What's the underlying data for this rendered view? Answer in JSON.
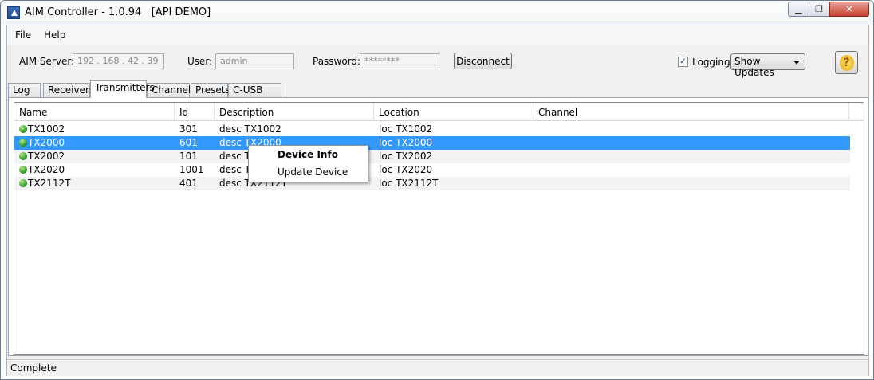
{
  "window": {
    "title": "AIM Controller - 1.0.94   [API DEMO]",
    "minimize": "▁",
    "maximize": "❐",
    "close": "✕"
  },
  "menu": {
    "file": "File",
    "help": "Help"
  },
  "connection": {
    "server_label": "AIM Server:",
    "server_value": "192 . 168 . 42 . 39",
    "user_label": "User:",
    "user_value": "admin",
    "password_label": "Password:",
    "password_value": "********",
    "disconnect_label": "Disconnect",
    "logging_label": "Logging",
    "logging_checked": "✓",
    "updates_select": "Show Updates",
    "help_icon": "?"
  },
  "tabs": [
    "Log",
    "Receivers",
    "Transmitters",
    "Channels",
    "Presets",
    "C-USB LAN"
  ],
  "active_tab": "Transmitters",
  "table": {
    "columns": [
      "Name",
      "Id",
      "Description",
      "Location",
      "Channel"
    ],
    "rows": [
      {
        "name": "TX1002",
        "id": "301",
        "description": "desc TX1002",
        "location": "loc TX1002",
        "channel": ""
      },
      {
        "name": "TX2000",
        "id": "601",
        "description": "desc TX2000",
        "location": "loc TX2000",
        "channel": ""
      },
      {
        "name": "TX2002",
        "id": "101",
        "description": "desc TX",
        "location": "loc TX2002",
        "channel": ""
      },
      {
        "name": "TX2020",
        "id": "1001",
        "description": "desc TX",
        "location": "loc TX2020",
        "channel": ""
      },
      {
        "name": "TX2112T",
        "id": "401",
        "description": "desc TX2112T",
        "location": "loc TX2112T",
        "channel": ""
      }
    ],
    "selected_row": "TX2000",
    "status_color": "#2aa01c"
  },
  "context_menu": {
    "items": [
      "Device Info",
      "Update Device"
    ]
  },
  "status_bar": {
    "text": "Complete"
  },
  "colors": {
    "selection": "#3399ff",
    "close_button": "#c8402d"
  }
}
